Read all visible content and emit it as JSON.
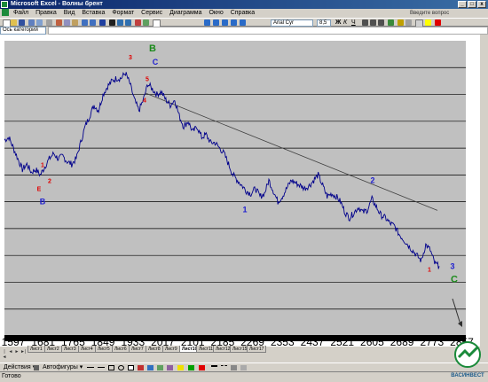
{
  "window": {
    "title": "Microsoft Excel - Волны брент",
    "controls": [
      "_",
      "□",
      "x"
    ]
  },
  "menu": [
    "Файл",
    "Правка",
    "Вид",
    "Вставка",
    "Формат",
    "Сервис",
    "Диаграмма",
    "Окно",
    "Справка"
  ],
  "help_placeholder": "Введите вопрос",
  "toolbar": {
    "font_name": "Arial Cyr",
    "font_size": "8,5"
  },
  "name_box": "Ось категорий",
  "chart_data": {
    "type": "line",
    "xlabel": "",
    "ylabel": "",
    "x_tick_labels": [
      "1597",
      "1681",
      "1765",
      "1849",
      "1933",
      "2017",
      "2101",
      "2185",
      "2269",
      "2353",
      "2437",
      "2521",
      "2605",
      "2689",
      "2773",
      "2857"
    ],
    "grid": true,
    "colors": {
      "series": "#00008b",
      "plot_bg": "#c0c0c0",
      "grid": "#000000",
      "trendline": "#404040"
    },
    "series": [
      {
        "values": [
          73,
          74,
          70,
          66,
          62,
          64,
          61,
          62,
          60,
          63,
          66,
          68,
          66,
          67,
          65,
          64,
          66,
          72,
          78,
          82,
          86,
          84,
          90,
          93,
          95,
          96,
          96,
          98,
          94,
          88,
          84,
          88,
          94,
          92,
          90,
          91,
          88,
          86,
          88,
          82,
          78,
          80,
          76,
          78,
          74,
          75,
          72,
          72,
          70,
          68,
          64,
          60,
          58,
          56,
          54,
          53,
          55,
          52,
          53,
          58,
          54,
          50,
          52,
          55,
          58,
          57,
          56,
          55,
          56,
          58,
          60,
          56,
          52,
          53,
          52,
          50,
          46,
          44,
          46,
          48,
          46,
          47,
          51,
          48,
          45,
          44,
          42,
          41,
          38,
          36,
          34,
          32,
          30,
          28,
          34,
          32,
          27,
          26
        ]
      }
    ],
    "trendline": {
      "x": [
        164,
        493
      ],
      "y": [
        90.5,
        46.8
      ]
    },
    "annotations": [
      {
        "text": "3",
        "color": "#e00000",
        "x": 147,
        "y": 103
      },
      {
        "text": "B",
        "color": "#1a8a1a",
        "x": 172,
        "y": 106
      },
      {
        "text": "5",
        "color": "#e00000",
        "x": 166,
        "y": 95
      },
      {
        "text": "C",
        "color": "#2020d0",
        "x": 175,
        "y": 101
      },
      {
        "text": "4",
        "color": "#e00000",
        "x": 163,
        "y": 87
      },
      {
        "text": "1",
        "color": "#e00000",
        "x": 48,
        "y": 63
      },
      {
        "text": "2",
        "color": "#e00000",
        "x": 56,
        "y": 57
      },
      {
        "text": "E",
        "color": "#e00000",
        "x": 44,
        "y": 54
      },
      {
        "text": "B",
        "color": "#2020d0",
        "x": 48,
        "y": 49
      },
      {
        "text": "1",
        "color": "#2020d0",
        "x": 276,
        "y": 46
      },
      {
        "text": "2",
        "color": "#2020d0",
        "x": 420,
        "y": 57
      },
      {
        "text": "1",
        "color": "#e00000",
        "x": 484,
        "y": 24
      },
      {
        "text": "3",
        "color": "#2020d0",
        "x": 510,
        "y": 25
      },
      {
        "text": "C",
        "color": "#1a8a1a",
        "x": 512,
        "y": 20
      }
    ]
  },
  "sheet_tabs": [
    "Лист1",
    "Лист2",
    "Лист3",
    "Лист4",
    "Лист5",
    "Лист6",
    "Лист7",
    "Лист8",
    "Лист9",
    "Лист10",
    "Лист11",
    "Лист12",
    "Лист15",
    "Лист17"
  ],
  "active_tab": "Лист10",
  "draw_toolbar": {
    "actions": "Действия ▾",
    "autoshapes": "Автофигуры ▾"
  },
  "status": "Готово",
  "logo_text": "ВАСИНВЕСТ"
}
